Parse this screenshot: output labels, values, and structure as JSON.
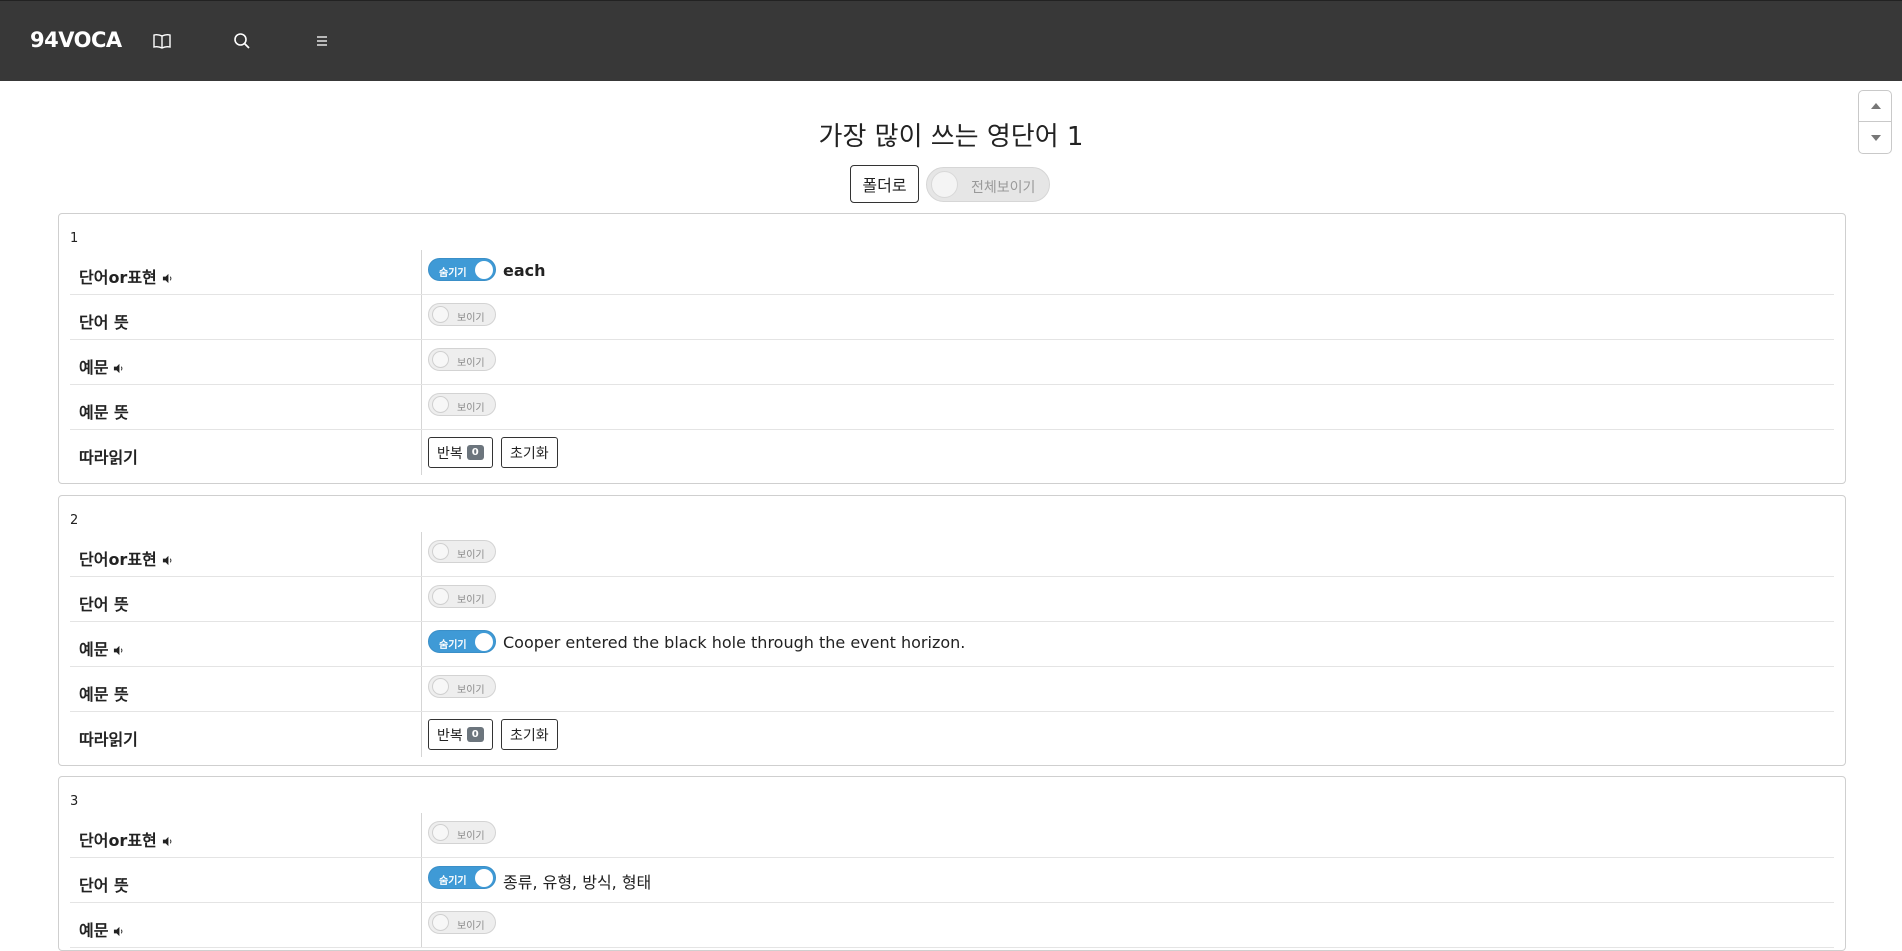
{
  "app": {
    "brand": "94VOCA"
  },
  "nav": {
    "icons": [
      "book-icon",
      "search-icon",
      "menu-icon"
    ]
  },
  "page": {
    "title": "가장 많이 쓰는 영단어 1",
    "folder_button": "폴더로",
    "show_all_label": "전체보이기"
  },
  "labels": {
    "word": "단어or표현",
    "word_meaning": "단어 뜻",
    "example": "예문",
    "example_meaning": "예문 뜻",
    "follow_read": "따라읽기",
    "hide": "숨기기",
    "show": "보이기",
    "repeat": "반복",
    "reset": "초기화"
  },
  "cards": [
    {
      "num": "1",
      "word": "each",
      "word_shown": true,
      "word_meaning": "",
      "word_meaning_shown": false,
      "example": "",
      "example_shown": false,
      "example_meaning": "",
      "example_meaning_shown": false,
      "repeat_count": "0"
    },
    {
      "num": "2",
      "word": "",
      "word_shown": false,
      "word_meaning": "",
      "word_meaning_shown": false,
      "example": "Cooper entered the black hole through the event horizon.",
      "example_shown": true,
      "example_meaning": "",
      "example_meaning_shown": false,
      "repeat_count": "0"
    },
    {
      "num": "3",
      "word": "",
      "word_shown": false,
      "word_meaning": "종류, 유형, 방식, 형태",
      "word_meaning_shown": true,
      "example": "",
      "example_shown": false
    }
  ],
  "colors": {
    "navbar": "#383838",
    "toggle_on": "#3f9ad6",
    "badge": "#6c757d"
  }
}
